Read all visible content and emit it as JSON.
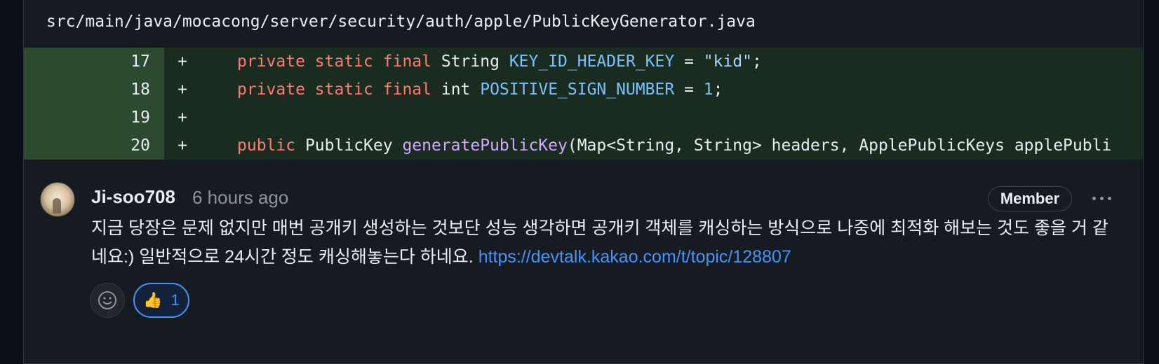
{
  "file": {
    "path": "src/main/java/mocacong/server/security/auth/apple/PublicKeyGenerator.java"
  },
  "diff": {
    "lines": [
      {
        "number": "17",
        "sign": "+"
      },
      {
        "number": "18",
        "sign": "+"
      },
      {
        "number": "19",
        "sign": "+"
      },
      {
        "number": "20",
        "sign": "+"
      }
    ],
    "tokens": {
      "private": "private",
      "static": "static",
      "final": "final",
      "public": "public",
      "string_type": "String",
      "int_type": "int",
      "key_id_const": "KEY_ID_HEADER_KEY",
      "positive_const": "POSITIVE_SIGN_NUMBER",
      "equals": "=",
      "kid_literal": "\"kid\"",
      "one_literal": "1",
      "semicolon": ";",
      "publickey_type": "PublicKey",
      "method_name": "generatePublicKey",
      "params": "(Map<String, String> headers, ApplePublicKeys applePubli"
    }
  },
  "comment": {
    "author": "Ji-soo708",
    "time": "6 hours ago",
    "badge": "Member",
    "body": "지금 당장은 문제 없지만 매번 공개키 생성하는 것보단 성능 생각하면 공개키 객체를 캐싱하는 방식으로 나중에 최적화 해보는 것도 좋을 거 같네요:) 일반적으로 24시간 정도 캐싱해놓는다 하네요. ",
    "link": "https://devtalk.kakao.com/t/topic/128807",
    "reactions": [
      {
        "icon": "thumbs-up-icon",
        "emoji": "👍",
        "count": "1"
      }
    ]
  },
  "colors": {
    "background": "#0d1117",
    "added_line": "#1a2b1f",
    "keyword": "#ff7b72",
    "constant": "#79c0ff",
    "function": "#d2a8ff",
    "link": "#4493f8"
  }
}
